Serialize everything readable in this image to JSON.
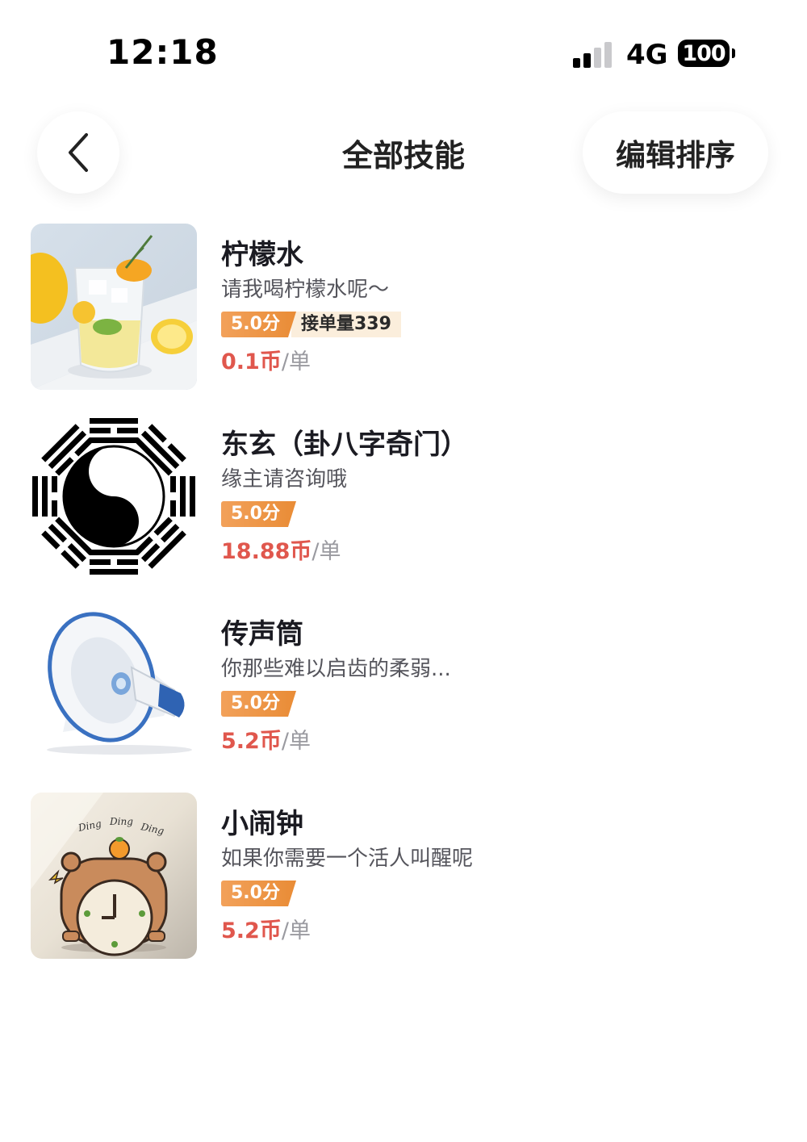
{
  "status_bar": {
    "time": "12:18",
    "network": "4G",
    "battery": "100"
  },
  "nav": {
    "title": "全部技能",
    "edit_label": "编辑排序",
    "back_icon": "chevron-left-icon"
  },
  "colors": {
    "price": "#e0574d",
    "score_badge": "#ec9440",
    "orders_badge": "#fbeedc"
  },
  "skills": [
    {
      "name": "柠檬水",
      "description": "请我喝柠檬水呢～",
      "score": "5.0分",
      "orders": "接单量339",
      "price": "0.1币",
      "unit": "/单",
      "image": "lemonade-glass-image"
    },
    {
      "name": "东玄（卦八字奇门）",
      "description": "缘主请咨询哦",
      "score": "5.0分",
      "price": "18.88币",
      "unit": "/单",
      "image": "yin-yang-bagua-image"
    },
    {
      "name": "传声筒",
      "description": "你那些难以启齿的柔弱...",
      "score": "5.0分",
      "price": "5.2币",
      "unit": "/单",
      "image": "megaphone-image"
    },
    {
      "name": "小闹钟",
      "description": "如果你需要一个活人叫醒呢",
      "score": "5.0分",
      "price": "5.2币",
      "unit": "/单",
      "image": "capybara-clock-image",
      "image_text": [
        "Ding",
        "Ding",
        "Ding"
      ]
    }
  ]
}
